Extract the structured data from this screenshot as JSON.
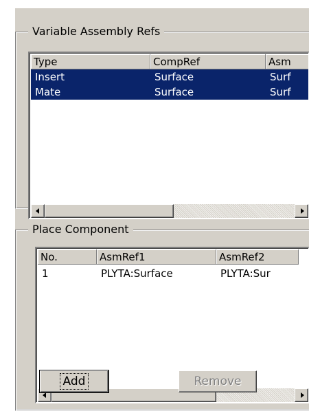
{
  "variable_assembly_refs": {
    "title": "Variable Assembly Refs",
    "columns": [
      "Type",
      "CompRef",
      "Asm"
    ],
    "rows": [
      {
        "type": "Insert",
        "compref": "Surface",
        "asmref": "Surf",
        "selected": true
      },
      {
        "type": "Mate",
        "compref": "Surface",
        "asmref": "Surf",
        "selected": true
      }
    ]
  },
  "place_component": {
    "title": "Place Component",
    "columns": [
      "No.",
      "AsmRef1",
      "AsmRef2"
    ],
    "rows": [
      {
        "no": "1",
        "asmref1": "PLYTA:Surface",
        "asmref2": "PLYTA:Sur"
      }
    ]
  },
  "buttons": {
    "add_label": "Add",
    "remove_label": "Remove",
    "remove_enabled": false
  },
  "colors": {
    "dialog_face": "#d4d0c8",
    "selection": "#0a246a",
    "selection_text": "#ffffff",
    "disabled_text": "#808080"
  }
}
